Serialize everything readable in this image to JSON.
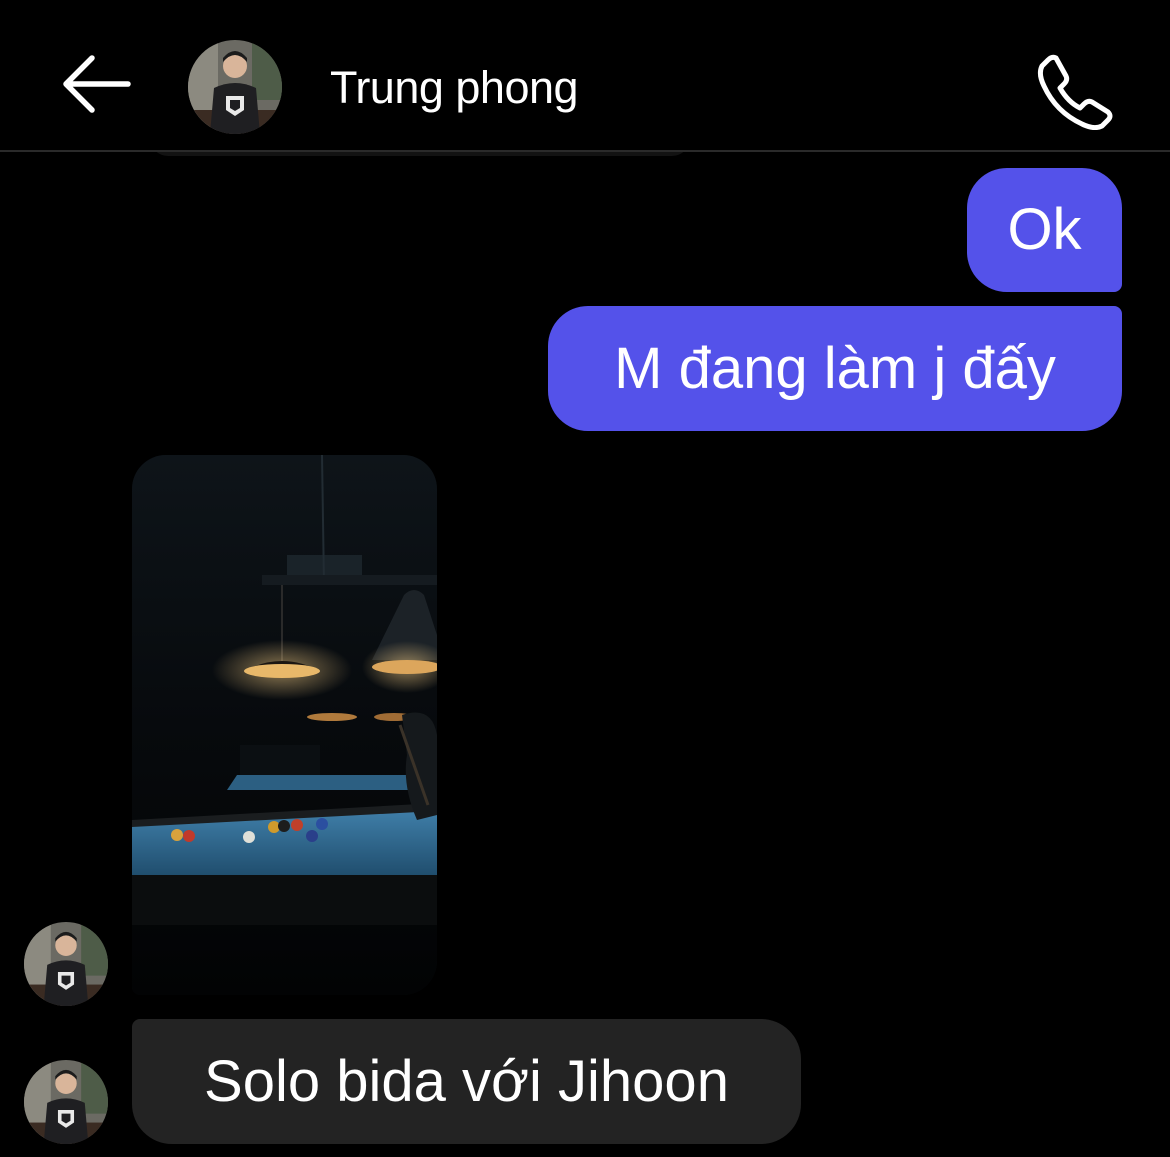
{
  "header": {
    "contact_name": "Trung phong",
    "back_icon": "arrow-left-icon",
    "call_icon": "phone-icon",
    "avatar_icon": "contact-avatar"
  },
  "messages": [
    {
      "direction": "outgoing",
      "type": "text",
      "text": "Ok"
    },
    {
      "direction": "outgoing",
      "type": "text",
      "text": "M đang làm j đấy"
    },
    {
      "direction": "incoming",
      "type": "photo",
      "description": "billiards-table-photo"
    },
    {
      "direction": "incoming",
      "type": "text",
      "text": "Solo bida với Jihoon"
    }
  ],
  "colors": {
    "background": "#000000",
    "outgoing_bubble": "#5452ea",
    "incoming_bubble": "#232323",
    "text": "#ffffff"
  }
}
